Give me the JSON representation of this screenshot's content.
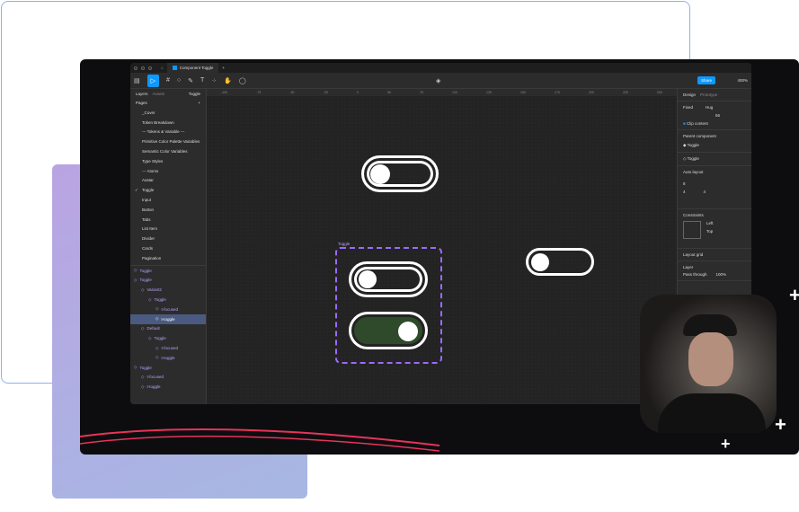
{
  "window": {
    "tab_title": "Component Toggle",
    "new_tab": "+"
  },
  "toolbar": {
    "share": "Share",
    "zoom": "400%"
  },
  "left_panel": {
    "tabs": [
      "Layers",
      "Assets"
    ],
    "page_selector": "Toggle",
    "pages_title": "Pages",
    "add": "+",
    "pages": [
      "_Cover",
      "Token Breakdown",
      "--- Tokens & Variable ---",
      "Primitive Color Palette Variables",
      "Semantic Color Variables",
      "Type Styles",
      "--- Atoms",
      "Avatar",
      "Toggle",
      "Input",
      "Button",
      "Tabs",
      "List Item",
      "Divider",
      "Cards",
      "Pagination"
    ],
    "current_page": "Toggle",
    "layers": [
      {
        "name": "Toggle",
        "indent": 0
      },
      {
        "name": "Toggle",
        "indent": 0
      },
      {
        "name": "Variant2",
        "indent": 1
      },
      {
        "name": "Toggle",
        "indent": 2
      },
      {
        "name": "t-focused",
        "indent": 3
      },
      {
        "name": "t-toggle",
        "indent": 3,
        "selected": true
      },
      {
        "name": "Default",
        "indent": 1
      },
      {
        "name": "Toggle",
        "indent": 2
      },
      {
        "name": "t-focused",
        "indent": 3
      },
      {
        "name": "t-toggle",
        "indent": 3
      },
      {
        "name": "Toggle",
        "indent": 0
      },
      {
        "name": "t-focused",
        "indent": 1
      },
      {
        "name": "t-toggle",
        "indent": 1
      }
    ]
  },
  "ruler": [
    "-100",
    "-75",
    "-50",
    "-25",
    "0",
    "96",
    "75",
    "100",
    "125",
    "150",
    "175",
    "200",
    "225",
    "250"
  ],
  "canvas": {
    "component_label": "Toggle"
  },
  "right_panel": {
    "tabs": [
      "Design",
      "Prototype"
    ],
    "width_mode": "Fixed",
    "height_mode": "Hug",
    "radius": "56",
    "clip_content": "Clip content",
    "parent_component_title": "Parent component",
    "parent_component": "Toggle",
    "instance": "Toggle",
    "auto_layout": "Auto layout",
    "gap": "8",
    "pad_h": "4",
    "pad_v": "4",
    "constraints": "Constraints",
    "constraint_h": "Left",
    "constraint_v": "Top",
    "layout_grid": "Layout grid",
    "layer": "Layer",
    "blend": "Pass through",
    "opacity": "100%"
  },
  "colors": {
    "accent": "#0d99ff",
    "component": "#9b6bff",
    "toggle_on": "#2f4a2a"
  }
}
